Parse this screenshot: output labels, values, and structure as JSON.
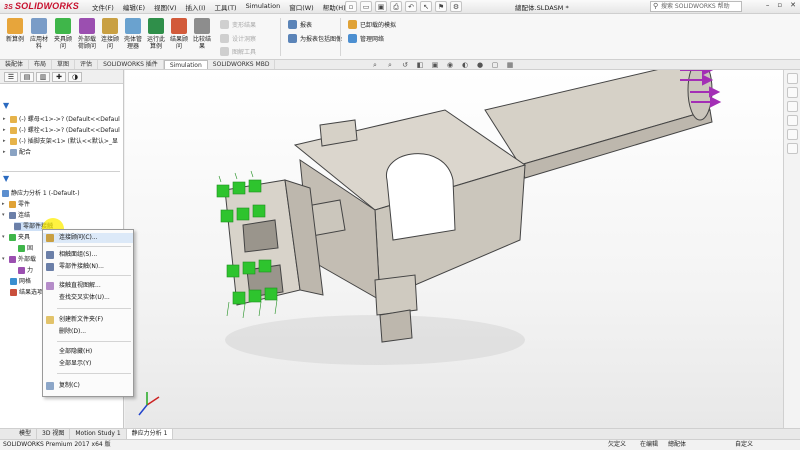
{
  "app": {
    "logo_text": "SOLIDWORKS",
    "document_title": "總配体.SLDASM *",
    "help_search": "搜索 SOLIDWORKS 帮助"
  },
  "menu": [
    "文件(F)",
    "编辑(E)",
    "视图(V)",
    "插入(I)",
    "工具(T)",
    "Simulation",
    "窗口(W)",
    "帮助(H)"
  ],
  "ribbon": {
    "new_study": "新算例",
    "apply_material": "应用材料",
    "fixtures": "夹具顾问",
    "external_loads": "外部载荷顾问",
    "connections": "连接顾问",
    "shell_manager": "壳体管理器",
    "run": "运行此算例",
    "results": "结果顾问",
    "compare": "比较结果",
    "deformed": "变形结果",
    "design_insight": "设计洞察",
    "plot_tools": "图解工具",
    "report": "报表",
    "include_image": "为报表包括图像",
    "loaded_plugins": "已卸载的模拟",
    "manage_network": "管理网络"
  },
  "tabs": [
    "装配体",
    "布局",
    "草图",
    "评估",
    "SOLIDWORKS 插件",
    "Simulation",
    "SOLIDWORKS MBD"
  ],
  "active_tab": "Simulation",
  "tree_top": [
    "(-) 螺母<1>->? (Default<<Defaul",
    "(-) 螺栓<1>->? (Default<<Defaul",
    "(-) 插脚支架<1> (默认<<默认>_显",
    "配合"
  ],
  "tree_study": {
    "study": "静应力分析 1 (-Default-)",
    "parts": "零件",
    "connections": "连结",
    "contact_set": "零部件接触",
    "fixtures": "夹具",
    "fixture_item": "固",
    "external_loads": "外部载",
    "force_item": "力",
    "mesh": "网格",
    "result_options": "结果选项"
  },
  "context_menu": [
    "连接顾问(C)...",
    "相触面组(S)...",
    "零部件接触(N)...",
    "接触直视图解...",
    "查找交叉实体(U)...",
    "创建新文件夹(F)",
    "删除(D)...",
    "全部隐藏(H)",
    "全部显示(Y)",
    "复制(C)"
  ],
  "bottom_tabs": [
    "模型",
    "3D 视图",
    "Motion Study 1",
    "静应力分析 1"
  ],
  "active_bottom_tab": "静应力分析 1",
  "status": {
    "left": "SOLIDWORKS Premium 2017 x64 版",
    "underdefined": "欠定义",
    "editing": "在编辑",
    "assembly": "總配体",
    "units": "自定义"
  },
  "colors": {
    "accent_red": "#c8102e",
    "fixture_green": "#2ec42e",
    "load_purple": "#a32fb5",
    "part_grey": "#d7d2c9",
    "highlight_yellow": "#ffee00"
  }
}
